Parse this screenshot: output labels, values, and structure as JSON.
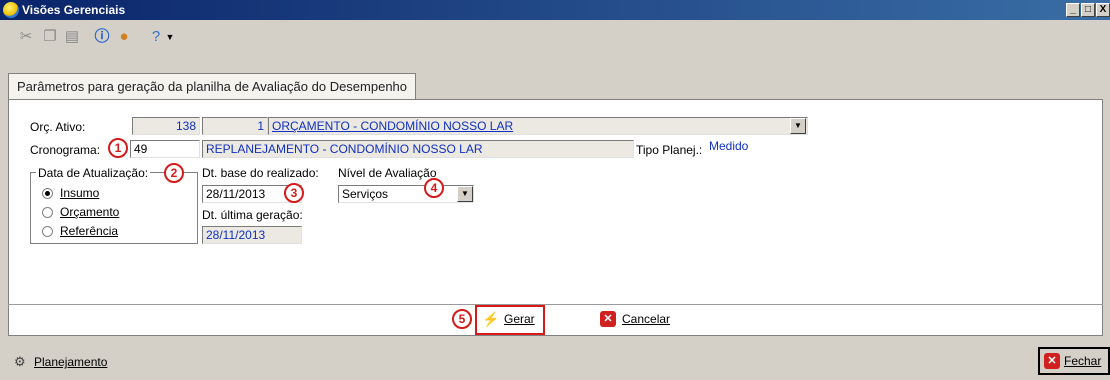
{
  "window": {
    "title": "Visões Gerenciais",
    "buttons": [
      "_",
      "□",
      "X"
    ]
  },
  "toolbar": {
    "icons": [
      "cut-icon",
      "copy-icon",
      "paste-icon",
      "info-icon",
      "user-icon",
      "help-icon",
      "dropdown-arrow-icon"
    ]
  },
  "tab": {
    "label": "Parâmetros para geração da planilha de Avaliação do Desempenho"
  },
  "form": {
    "orc_label": "Orç. Ativo:",
    "orc_code": "138",
    "orc_num": "1",
    "orc_desc": "ORÇAMENTO - CONDOMÍNIO NOSSO LAR",
    "crono_label": "Cronograma:",
    "crono_value": "49",
    "crono_desc": "REPLANEJAMENTO - CONDOMÍNIO NOSSO LAR",
    "tipo_label": "Tipo Planej.:",
    "tipo_value": "Medido",
    "data_atual_label": "Data de Atualização:",
    "radio_insumo": "Insumo",
    "radio_orcamento": "Orçamento",
    "radio_referencia": "Referência",
    "dt_base_label": "Dt. base do realizado:",
    "dt_base_value": "28/11/2013",
    "dt_ultima_label": "Dt. última geração:",
    "dt_ultima_value": "28/11/2013",
    "nivel_label": "Nível de Avaliação",
    "nivel_value": "Serviços"
  },
  "badges": [
    "1",
    "2",
    "3",
    "4",
    "5"
  ],
  "actions": {
    "gerar": "Gerar",
    "cancelar": "Cancelar"
  },
  "status": {
    "planejamento": "Planejamento",
    "fechar": "Fechar"
  },
  "colors": {
    "title_bar": "#0a246a",
    "highlight": "#d41a1a",
    "link_text": "#1030c0"
  }
}
